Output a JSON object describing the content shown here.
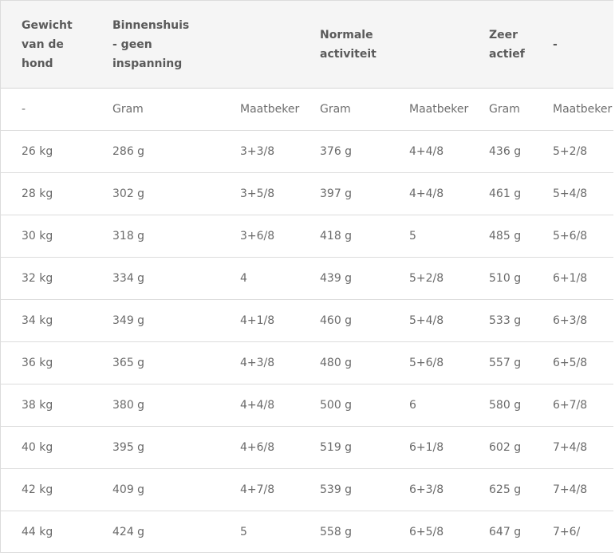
{
  "header": {
    "weight": "Gewicht van de hond",
    "indoor": "Binnenshuis - geen inspanning",
    "normal": "Normale activiteit",
    "very_active": "Zeer actief",
    "extra": "-"
  },
  "subheader": [
    "-",
    "Gram",
    "Maatbeker",
    "Gram",
    "Maatbeker",
    "Gram",
    "Maatbeker"
  ],
  "rows": [
    [
      "26 kg",
      "286 g",
      "3+3/8",
      "376 g",
      "4+4/8",
      "436 g",
      "5+2/8"
    ],
    [
      "28 kg",
      "302 g",
      "3+5/8",
      "397 g",
      "4+4/8",
      "461 g",
      "5+4/8"
    ],
    [
      "30 kg",
      "318 g",
      "3+6/8",
      "418 g",
      "5",
      "485 g",
      "5+6/8"
    ],
    [
      "32 kg",
      "334 g",
      "4",
      "439 g",
      "5+2/8",
      "510 g",
      "6+1/8"
    ],
    [
      "34 kg",
      "349 g",
      "4+1/8",
      "460 g",
      "5+4/8",
      "533 g",
      "6+3/8"
    ],
    [
      "36 kg",
      "365 g",
      "4+3/8",
      "480 g",
      "5+6/8",
      "557 g",
      "6+5/8"
    ],
    [
      "38 kg",
      "380 g",
      "4+4/8",
      "500 g",
      "6",
      "580 g",
      "6+7/8"
    ],
    [
      "40 kg",
      "395 g",
      "4+6/8",
      "519 g",
      "6+1/8",
      "602 g",
      "7+4/8"
    ],
    [
      "42 kg",
      "409 g",
      "4+7/8",
      "539 g",
      "6+3/8",
      "625 g",
      "7+4/8"
    ],
    [
      "44 kg",
      "424 g",
      "5",
      "558 g",
      "6+5/8",
      "647 g",
      "7+6/"
    ]
  ]
}
